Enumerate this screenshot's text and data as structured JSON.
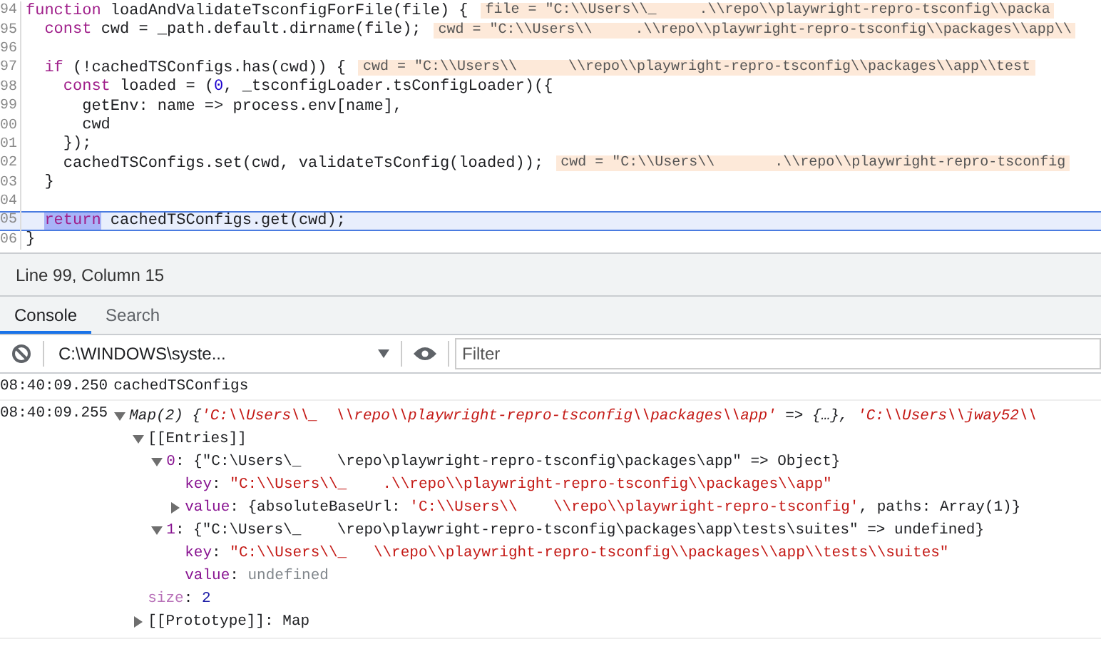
{
  "editor": {
    "lines": [
      {
        "number": "94",
        "current": false,
        "tokens": [
          {
            "text": "function",
            "kind": "keyword"
          },
          {
            "text": " loadAndValidateTsconfigForFile(file) {",
            "kind": "plain"
          }
        ],
        "inline_value": "file = \"C:\\\\Users\\\\_     .\\\\repo\\\\playwright-repro-tsconfig\\\\packa"
      },
      {
        "number": "95",
        "current": false,
        "tokens": [
          {
            "text": "  const",
            "kind": "keyword"
          },
          {
            "text": " cwd = _path.default.dirname(file);",
            "kind": "plain"
          }
        ],
        "inline_value": "cwd = \"C:\\\\Users\\\\     .\\\\repo\\\\playwright-repro-tsconfig\\\\packages\\\\app\\\\"
      },
      {
        "number": "96",
        "current": false
      },
      {
        "number": "97",
        "current": false,
        "tokens": [
          {
            "text": "  if",
            "kind": "keyword"
          },
          {
            "text": " (!cachedTSConfigs.has(cwd)) {",
            "kind": "plain"
          }
        ],
        "inline_value": "cwd = \"C:\\\\Users\\\\      \\\\repo\\\\playwright-repro-tsconfig\\\\packages\\\\app\\\\test"
      },
      {
        "number": "98",
        "current": false,
        "tokens": [
          {
            "text": "    const",
            "kind": "keyword"
          },
          {
            "text": " loaded = (",
            "kind": "plain"
          },
          {
            "text": "0",
            "kind": "number"
          },
          {
            "text": ", _tsconfigLoader.tsConfigLoader)({",
            "kind": "plain"
          }
        ]
      },
      {
        "number": "99",
        "current": false,
        "tokens": [
          {
            "text": "      getEnv: name => process.env[name],",
            "kind": "plain"
          }
        ]
      },
      {
        "number": "00",
        "current": false,
        "tokens": [
          {
            "text": "      cwd",
            "kind": "plain"
          }
        ]
      },
      {
        "number": "01",
        "current": false,
        "tokens": [
          {
            "text": "    });",
            "kind": "plain"
          }
        ]
      },
      {
        "number": "02",
        "current": false,
        "tokens": [
          {
            "text": "    cachedTSConfigs.set(cwd, validateTsConfig(loaded));",
            "kind": "plain"
          }
        ],
        "inline_value": "cwd = \"C:\\\\Users\\\\       .\\\\repo\\\\playwright-repro-tsconfig"
      },
      {
        "number": "03",
        "current": false,
        "tokens": [
          {
            "text": "  }",
            "kind": "plain"
          }
        ]
      },
      {
        "number": "04",
        "current": false
      },
      {
        "number": "05",
        "current": true,
        "tokens": [
          {
            "text": "  return",
            "kind": "selected-keyword"
          },
          {
            "text": " cachedTSConfigs.get(cwd);",
            "kind": "plain"
          }
        ]
      },
      {
        "number": "06",
        "current": false,
        "tokens": [
          {
            "text": "}",
            "kind": "plain"
          }
        ]
      }
    ]
  },
  "status_bar": {
    "text": "Line 99, Column 15"
  },
  "drawer": {
    "tabs": [
      {
        "label": "Console",
        "selected": true
      },
      {
        "label": "Search",
        "selected": false
      }
    ],
    "toolbar": {
      "context": "C:\\WINDOWS\\syste...",
      "filter": {
        "placeholder": "Filter"
      }
    },
    "messages": [
      {
        "time": "08:40:09.250",
        "text": "cachedTSConfigs"
      },
      {
        "time": "08:40:09.255",
        "tree": {
          "expanded": true,
          "segments": [
            {
              "text": "Map(2) {",
              "kind": "preview"
            },
            {
              "text": "'C:\\\\Users\\\\_  \\\\repo\\\\playwright-repro-tsconfig\\\\packages\\\\app'",
              "kind": "preview-string"
            },
            {
              "text": " => {…}, ",
              "kind": "preview"
            },
            {
              "text": "'C:\\\\Users\\\\jway52\\\\",
              "kind": "preview-string"
            }
          ],
          "children": [
            {
              "expanded": true,
              "segments": [
                {
                  "text": "[[Entries]]",
                  "kind": "plain"
                }
              ],
              "children": [
                {
                  "expanded": true,
                  "segments": [
                    {
                      "text": "0",
                      "kind": "name"
                    },
                    {
                      "text": ": {\"C:\\Users\\_    \\repo\\playwright-repro-tsconfig\\packages\\app\" => Object}",
                      "kind": "plain"
                    }
                  ],
                  "children": [
                    {
                      "segments": [
                        {
                          "text": "key",
                          "kind": "name"
                        },
                        {
                          "text": ": ",
                          "kind": "plain"
                        },
                        {
                          "text": "\"C:\\\\Users\\\\_    .\\\\repo\\\\playwright-repro-tsconfig\\\\packages\\\\app\"",
                          "kind": "string"
                        }
                      ]
                    },
                    {
                      "expanded": false,
                      "segments": [
                        {
                          "text": "value",
                          "kind": "name"
                        },
                        {
                          "text": ": {absoluteBaseUrl: ",
                          "kind": "plain"
                        },
                        {
                          "text": "'C:\\\\Users\\\\    \\\\repo\\\\playwright-repro-tsconfig'",
                          "kind": "string"
                        },
                        {
                          "text": ", paths: Array(1)}",
                          "kind": "plain"
                        }
                      ]
                    }
                  ]
                },
                {
                  "expanded": true,
                  "segments": [
                    {
                      "text": "1",
                      "kind": "name"
                    },
                    {
                      "text": ": {\"C:\\Users\\_    \\repo\\playwright-repro-tsconfig\\packages\\app\\tests\\suites\" => undefined}",
                      "kind": "plain"
                    }
                  ],
                  "children": [
                    {
                      "segments": [
                        {
                          "text": "key",
                          "kind": "name"
                        },
                        {
                          "text": ": ",
                          "kind": "plain"
                        },
                        {
                          "text": "\"C:\\\\Users\\\\_   \\\\repo\\\\playwright-repro-tsconfig\\\\packages\\\\app\\\\tests\\\\suites\"",
                          "kind": "string"
                        }
                      ]
                    },
                    {
                      "segments": [
                        {
                          "text": "value",
                          "kind": "name"
                        },
                        {
                          "text": ": ",
                          "kind": "plain"
                        },
                        {
                          "text": "undefined",
                          "kind": "undefined"
                        }
                      ]
                    }
                  ]
                }
              ]
            },
            {
              "segments": [
                {
                  "text": "size",
                  "kind": "meta-name"
                },
                {
                  "text": ": ",
                  "kind": "plain"
                },
                {
                  "text": "2",
                  "kind": "number"
                }
              ]
            },
            {
              "expanded": false,
              "segments": [
                {
                  "text": "[[Prototype]]: Map",
                  "kind": "plain"
                }
              ]
            }
          ]
        }
      }
    ]
  }
}
